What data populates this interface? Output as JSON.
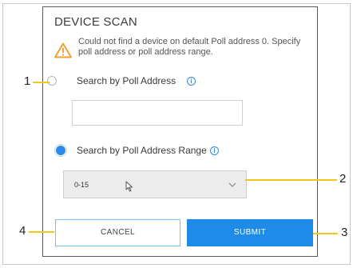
{
  "dialog": {
    "title": "DEVICE SCAN",
    "warning": "Could not find a device on default Poll address 0. Specify poll address or poll address range.",
    "option_address_label": "Search by Poll Address",
    "option_range_label": "Search by Poll Address Range",
    "address_value": "",
    "range_selected": "0-15",
    "cancel_label": "CANCEL",
    "submit_label": "SUBMIT"
  },
  "callouts": [
    "1",
    "2",
    "3",
    "4"
  ],
  "colors": {
    "accent": "#1e8be8",
    "callout": "#f2c51c",
    "warning": "#f0a23a"
  }
}
